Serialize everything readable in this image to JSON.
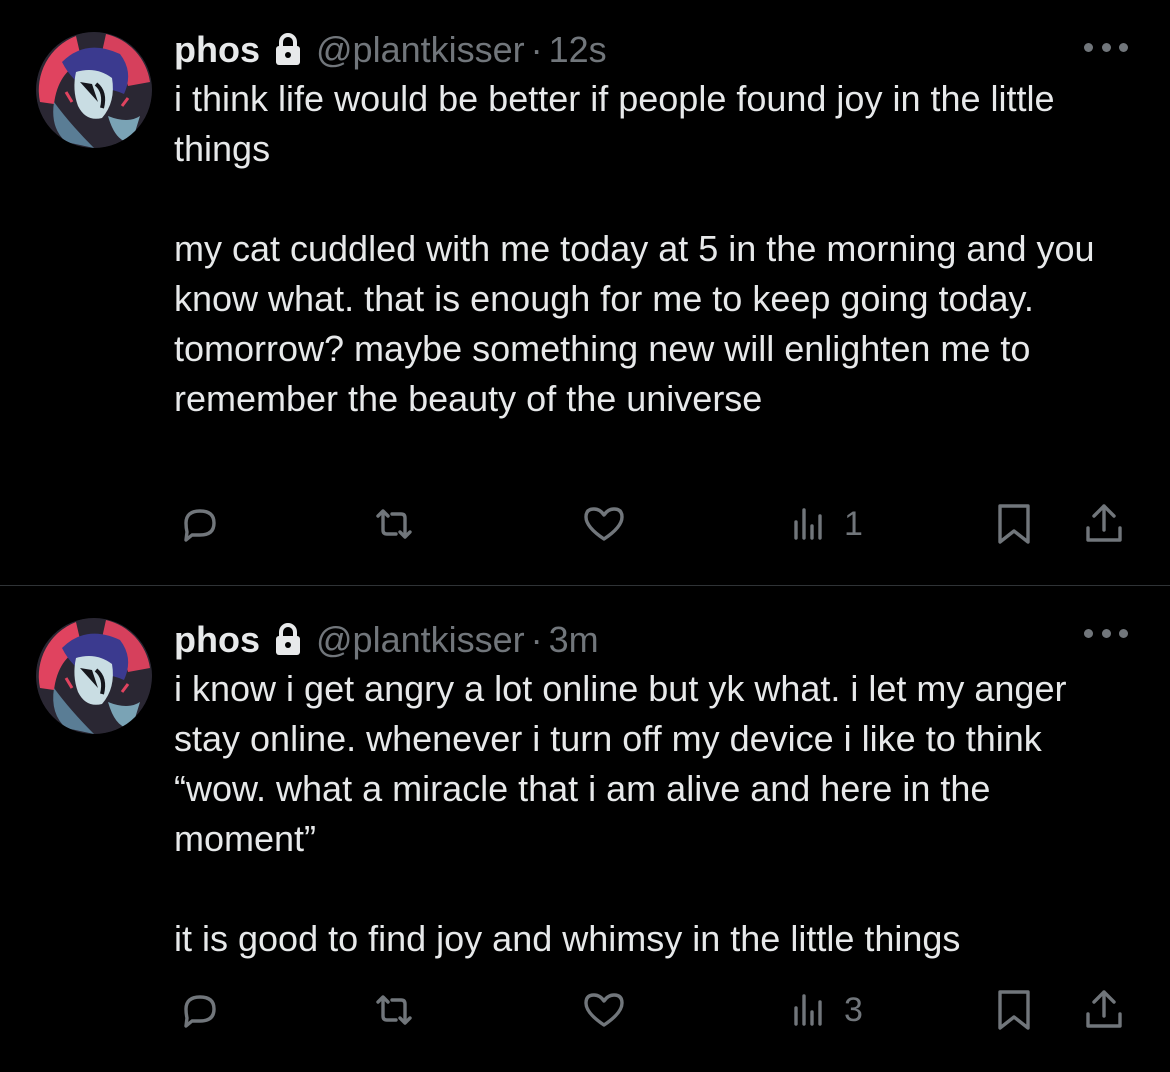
{
  "tweets": [
    {
      "name": "phos",
      "handle": "@plantkisser",
      "separator": "·",
      "time": "12s",
      "paragraphs": [
        "i think life would be better if people found joy in the little things",
        "my cat cuddled with me today at 5 in the morning and you know what. that is enough for me to keep going today. tomorrow? maybe something new will enlighten me to remember the beauty of the universe"
      ],
      "views": "1"
    },
    {
      "name": "phos",
      "handle": "@plantkisser",
      "separator": "·",
      "time": "3m",
      "paragraphs": [
        "i know i get angry a lot online but yk what. i let my anger stay online. whenever i turn off my device i like to think “wow. what a miracle that i am alive and here in the moment”",
        "it is good to find joy and whimsy in the little things"
      ],
      "views": "3"
    }
  ],
  "icons": {
    "lock": "lock-icon",
    "more": "more-icon",
    "reply": "reply-icon",
    "retweet": "retweet-icon",
    "like": "heart-icon",
    "views": "views-icon",
    "bookmark": "bookmark-icon",
    "share": "share-icon"
  },
  "colors": {
    "background": "#000000",
    "text": "#e7e9ea",
    "muted": "#71767b",
    "divider": "#2f3336",
    "avatar_ring": "#e0435f"
  }
}
